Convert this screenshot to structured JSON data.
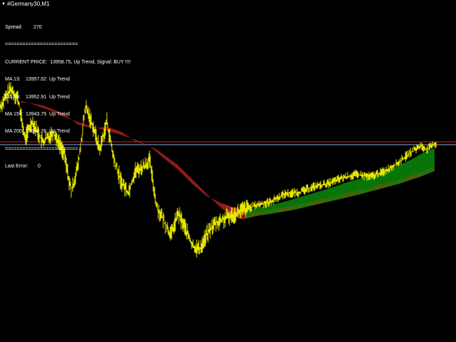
{
  "window": {
    "title": "#Germany30,M1"
  },
  "panel": {
    "spread_label": "Spread:",
    "spread_value": "270",
    "separator_top": "=========================",
    "current_price": "CURRENT PRICE:  13958.75, Up Trend, Signal: BUY !!!!",
    "ma": [
      {
        "label": "MA 13:",
        "value": "13957.02",
        "trend": "Up Trend"
      },
      {
        "label": "MA 59:",
        "value": "13952.91",
        "trend": "Up Trend"
      },
      {
        "label": "MA 154:",
        "value": "13943.75",
        "trend": "Up Trend"
      },
      {
        "label": "MA 200:",
        "value": "13940.26",
        "trend": "Up Trend"
      }
    ],
    "separator_bottom": "=========================",
    "last_error_label": "Last Error:",
    "last_error_value": "0"
  },
  "colors": {
    "background": "#000000",
    "price": "#e6e600",
    "down_band": "#b22222",
    "down_band_stripe": "#5a0c0c",
    "up_band": "#0a7a0a",
    "up_band_stripe": "#b45a14",
    "level_red": "#e02020",
    "level_blue": "#8aa8d8"
  },
  "chart_data": {
    "type": "line",
    "symbol": "Germany30",
    "timeframe": "M1",
    "current_price": 13958.75,
    "moving_averages": [
      {
        "name": "MA 13",
        "value": 13957.02
      },
      {
        "name": "MA 59",
        "value": 13952.91
      },
      {
        "name": "MA 154",
        "value": 13943.75
      },
      {
        "name": "MA 200",
        "value": 13940.26
      }
    ]
  }
}
